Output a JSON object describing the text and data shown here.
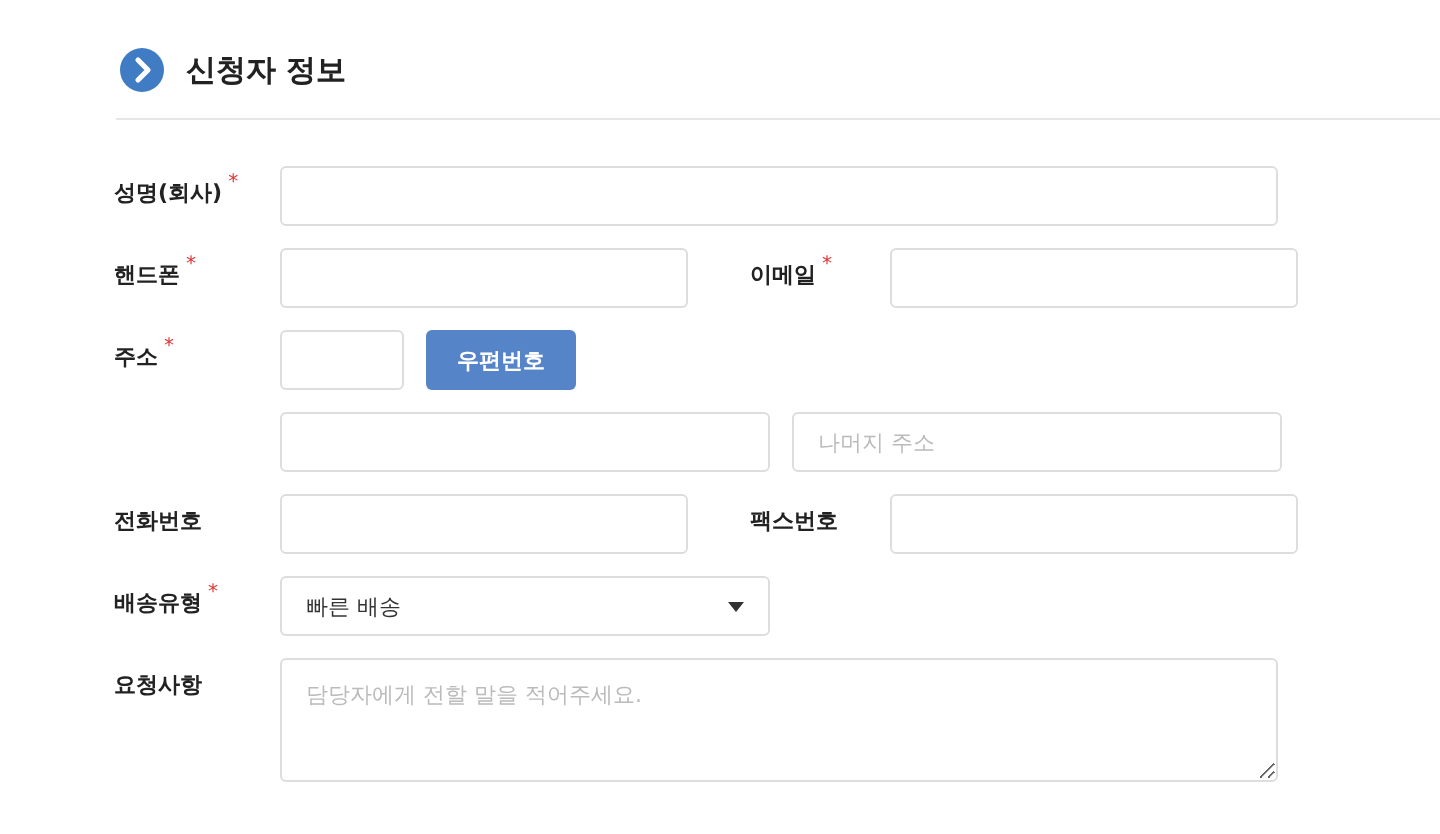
{
  "header": {
    "title": "신청자 정보"
  },
  "rows": [
    {
      "kind": "full",
      "label": "성명(회사)",
      "mark": "*"
    },
    {
      "kind": "pair",
      "label": "핸드폰",
      "mark": "*",
      "label_2": "이메일",
      "mark_2": "*"
    },
    {
      "kind": "zip",
      "label": "주소",
      "mark": "*",
      "button": "우편번호"
    },
    {
      "kind": "address",
      "placeholder_2": "나머지 주소"
    },
    {
      "kind": "pair",
      "label": "전화번호",
      "label_2": "팩스번호"
    },
    {
      "kind": "select",
      "label": "배송유형",
      "mark": "*",
      "value": "빠른 배송"
    },
    {
      "kind": "textarea",
      "label": "요청사항",
      "placeholder": "담당자에게 전할 말을 적어주세요."
    }
  ]
}
